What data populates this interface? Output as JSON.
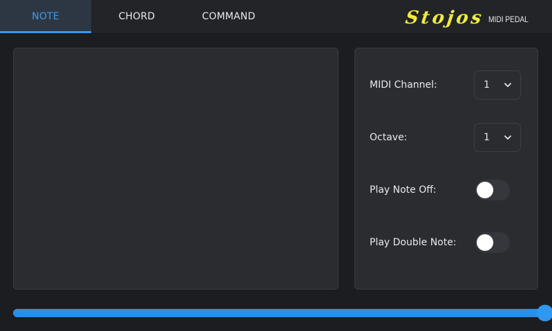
{
  "tabs": [
    {
      "label": "NOTE",
      "active": true
    },
    {
      "label": "CHORD",
      "active": false
    },
    {
      "label": "COMMAND",
      "active": false
    }
  ],
  "logo": {
    "script": "Stojos",
    "subtitle": "MIDI PEDAL"
  },
  "settings": {
    "midi_channel": {
      "label": "MIDI Channel:",
      "value": "1"
    },
    "octave": {
      "label": "Octave:",
      "value": "1"
    },
    "play_note_off": {
      "label": "Play Note Off:",
      "on": false
    },
    "play_double_note": {
      "label": "Play Double Note:",
      "on": false
    }
  },
  "slider": {
    "value": 1.0
  },
  "colors": {
    "accent": "#3a95ee",
    "logo_yellow": "#f0ec3b",
    "background": "#1b1d20",
    "panel": "#2a2c30"
  },
  "icons": {
    "select_arrow": "chevron-down-icon"
  }
}
